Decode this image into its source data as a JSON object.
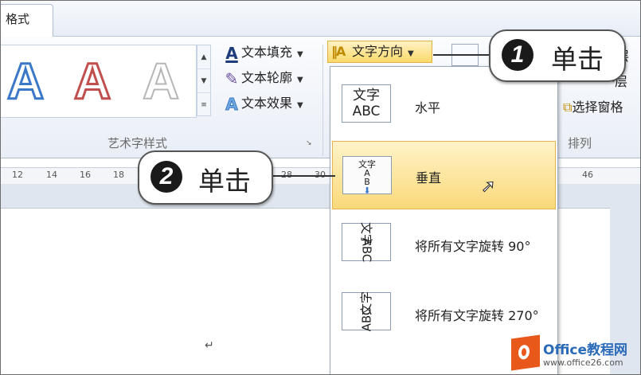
{
  "tab": {
    "label": "格式"
  },
  "art_styles": {
    "group_label": "艺术字样式",
    "letter": "A",
    "text_fill": "文本填充",
    "text_outline": "文本轮廓",
    "text_effect": "文本效果"
  },
  "toolbar": {
    "text_direction": "文字方向"
  },
  "arrange": {
    "group_label": "排列",
    "select_pane": "选择窗格",
    "layer1": "层",
    "layer2": "一层"
  },
  "ruler": {
    "ticks": [
      "12",
      "14",
      "16",
      "18",
      "28",
      "30",
      "46"
    ]
  },
  "menu": {
    "items": [
      {
        "label": "水平",
        "icon_text": "文字\nABC"
      },
      {
        "label": "垂直",
        "icon_text": "文字ABC"
      },
      {
        "label": "将所有文字旋转 90°",
        "icon_text": "文字ABC"
      },
      {
        "label": "将所有文字旋转 270°",
        "icon_text": "文字ABC"
      }
    ]
  },
  "callouts": [
    {
      "number": "1",
      "text": "单击"
    },
    {
      "number": "2",
      "text": "单击"
    }
  ],
  "document": {
    "paragraph_mark": "↵"
  },
  "watermark": {
    "title": "Office教程网",
    "url": "www.office26.com"
  },
  "colors": {
    "highlight": "#fbd96a",
    "accent_blue": "#3c78c8",
    "watermark_orange": "#e8581b"
  }
}
